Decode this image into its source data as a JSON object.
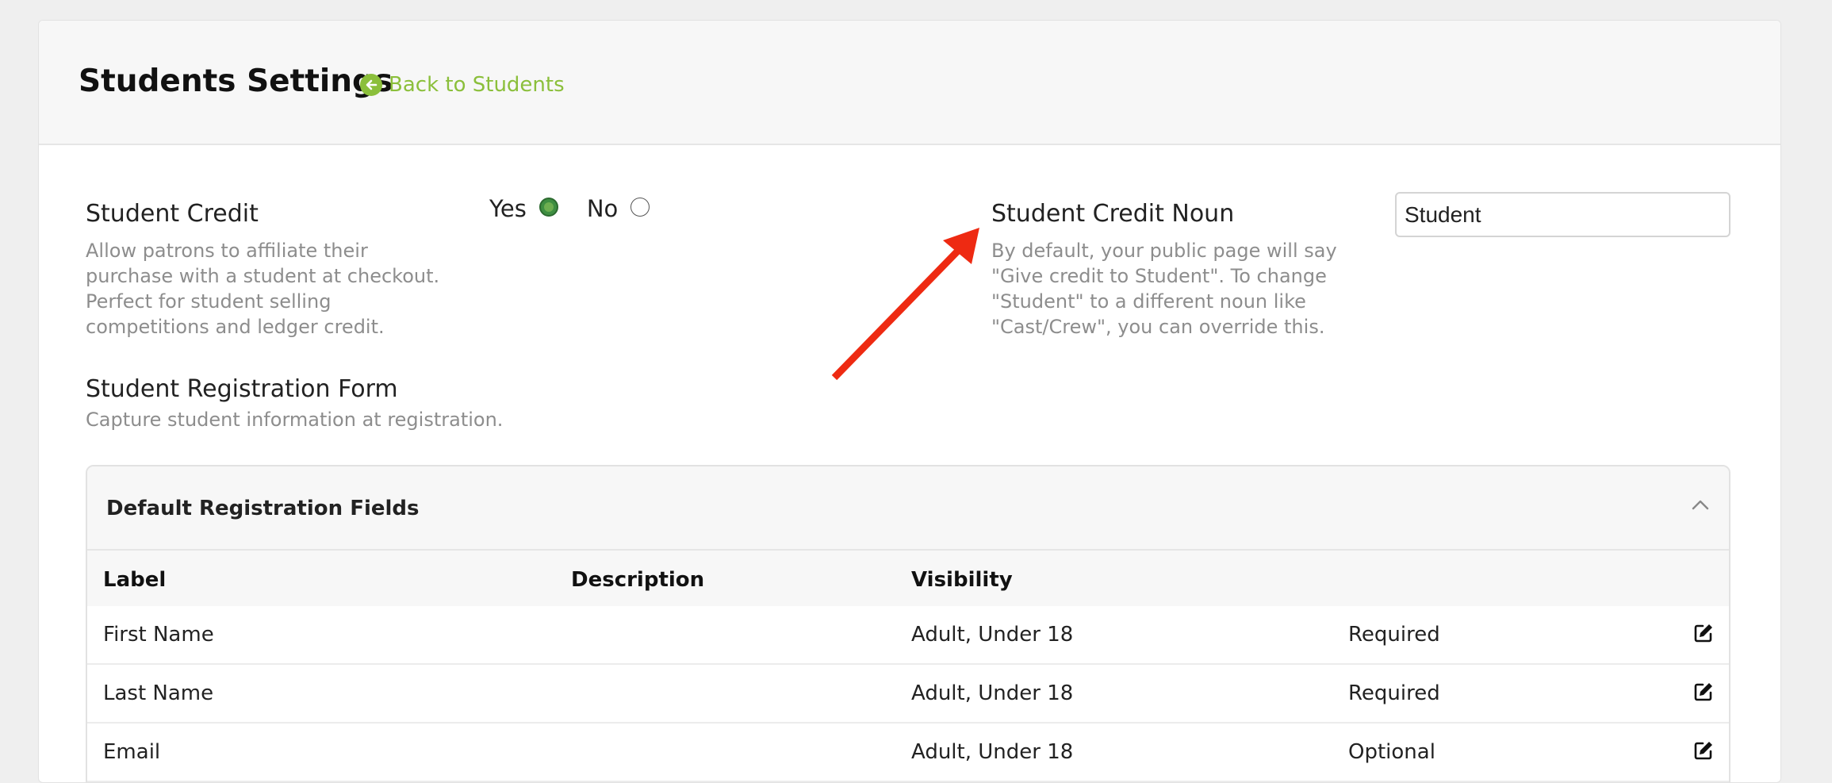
{
  "header": {
    "title": "Students Settings",
    "back_link": "Back to Students"
  },
  "student_credit": {
    "title": "Student Credit",
    "description": "Allow patrons to affiliate their purchase with a student at checkout. Perfect for student selling competitions and ledger credit.",
    "options": [
      {
        "label": "Yes",
        "selected": true
      },
      {
        "label": "No",
        "selected": false
      }
    ]
  },
  "credit_noun": {
    "title": "Student Credit Noun",
    "description": "By default, your public page will say \"Give credit to Student\". To change \"Student\" to a different noun like \"Cast/Crew\", you can override this.",
    "value": "Student"
  },
  "registration_form": {
    "title": "Student Registration Form",
    "description": "Capture student information at registration."
  },
  "default_fields": {
    "title": "Default Registration Fields",
    "columns": [
      "Label",
      "Description",
      "Visibility"
    ],
    "rows": [
      {
        "label": "First Name",
        "description": "",
        "visibility": "Adult, Under 18",
        "requirement": "Required"
      },
      {
        "label": "Last Name",
        "description": "",
        "visibility": "Adult, Under 18",
        "requirement": "Required"
      },
      {
        "label": "Email",
        "description": "",
        "visibility": "Adult, Under 18",
        "requirement": "Optional"
      }
    ]
  },
  "colors": {
    "accent": "#8bbf3b",
    "radio_selected": "#3e8e41",
    "annotation_arrow": "#ee2a12"
  },
  "icons": [
    "arrow-circle-left-icon",
    "chevron-up-icon",
    "edit-icon"
  ]
}
